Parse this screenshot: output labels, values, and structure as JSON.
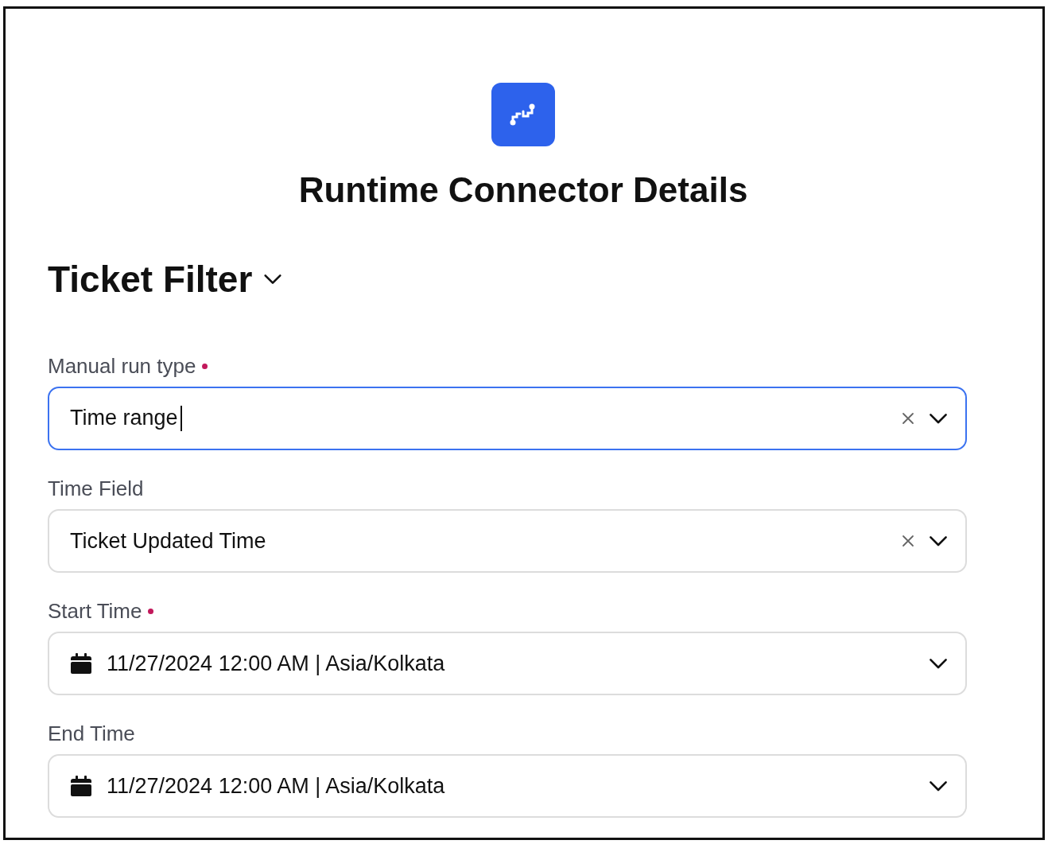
{
  "header": {
    "title": "Runtime Connector Details"
  },
  "section": {
    "title": "Ticket Filter",
    "expanded": true
  },
  "fields": [
    {
      "kind": "select",
      "label": "Manual run type",
      "required": true,
      "value": "Time range",
      "focused": true,
      "clearable": true
    },
    {
      "kind": "select",
      "label": "Time Field",
      "required": false,
      "value": "Ticket Updated Time",
      "focused": false,
      "clearable": true
    },
    {
      "kind": "date",
      "label": "Start Time",
      "required": true,
      "value": "11/27/2024 12:00 AM | Asia/Kolkata",
      "focused": false,
      "clearable": false
    },
    {
      "kind": "date",
      "label": "End Time",
      "required": false,
      "value": "11/27/2024 12:00 AM | Asia/Kolkata",
      "focused": false,
      "clearable": false
    }
  ]
}
